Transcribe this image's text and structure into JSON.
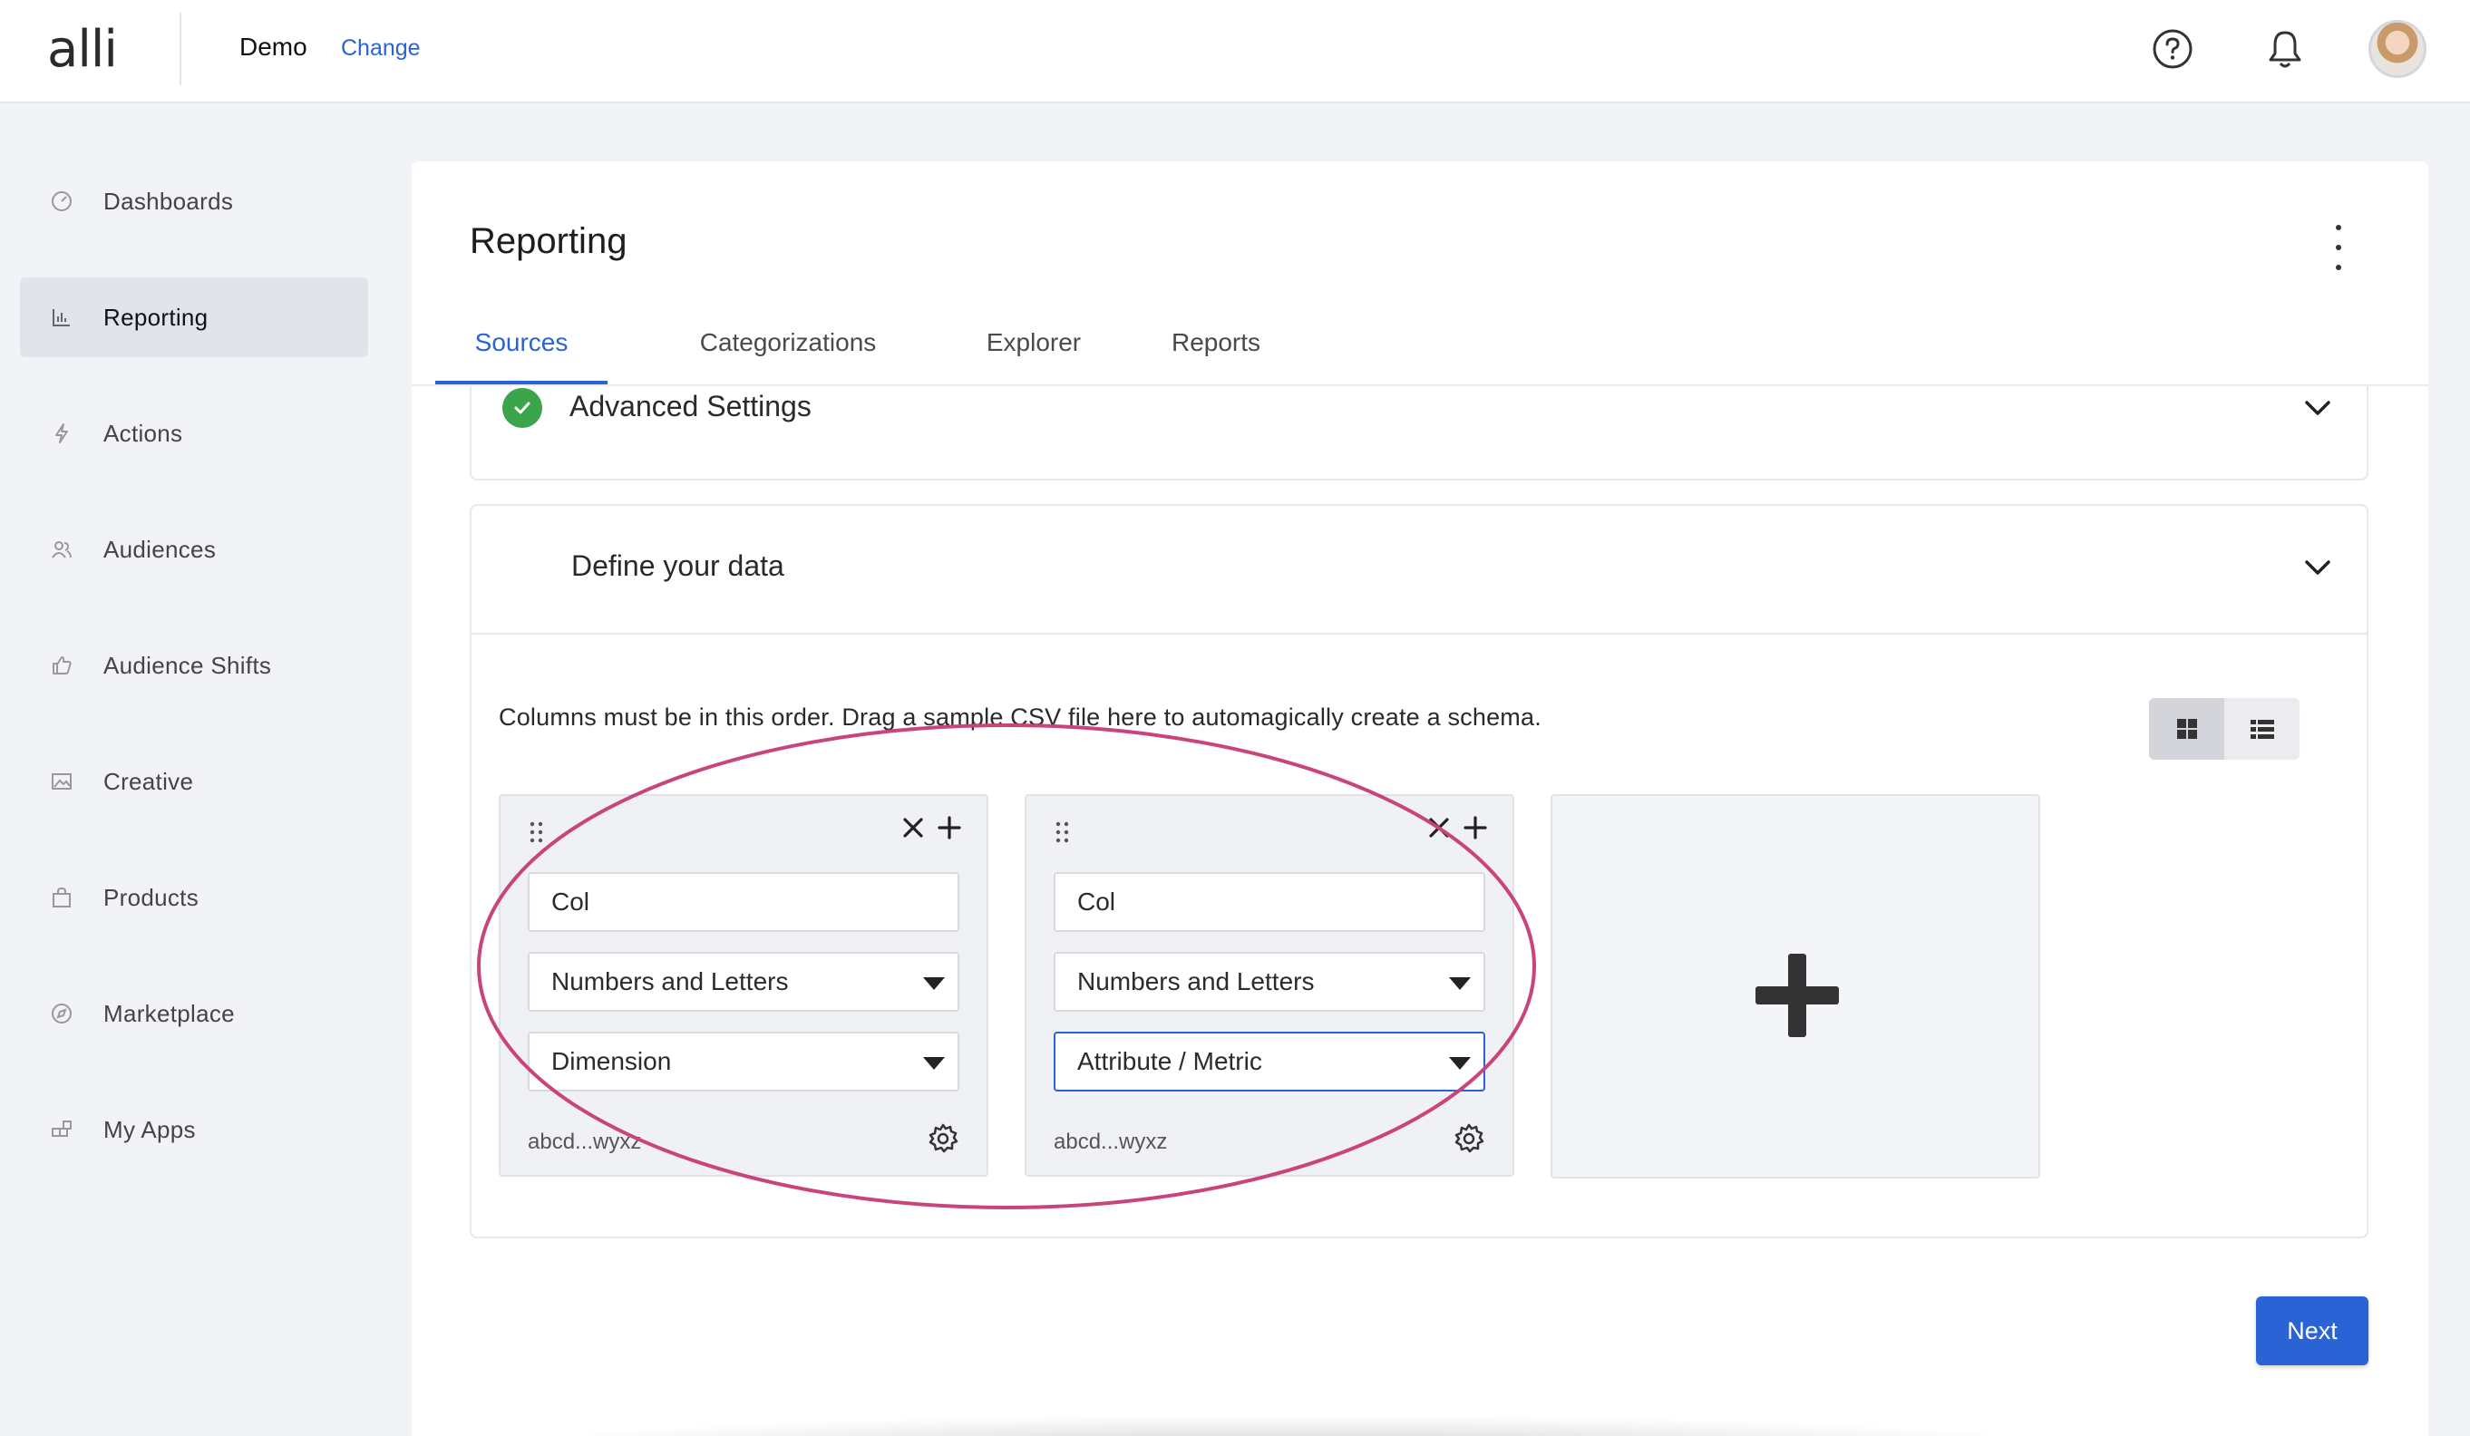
{
  "header": {
    "logo_text": "alli",
    "client_name": "Demo",
    "change_label": "Change",
    "icons": [
      "help-icon",
      "bell-icon",
      "avatar"
    ]
  },
  "sidebar": {
    "items": [
      {
        "label": "Dashboards",
        "icon": "gauge-icon",
        "active": false
      },
      {
        "label": "Reporting",
        "icon": "bar-chart-icon",
        "active": true
      },
      {
        "label": "Actions",
        "icon": "lightning-icon",
        "active": false
      },
      {
        "label": "Audiences",
        "icon": "people-icon",
        "active": false
      },
      {
        "label": "Audience Shifts",
        "icon": "thumbs-up-icon",
        "active": false
      },
      {
        "label": "Creative",
        "icon": "image-icon",
        "active": false
      },
      {
        "label": "Products",
        "icon": "bag-icon",
        "active": false
      },
      {
        "label": "Marketplace",
        "icon": "compass-icon",
        "active": false
      },
      {
        "label": "My Apps",
        "icon": "apps-icon",
        "active": false
      }
    ]
  },
  "main": {
    "title": "Reporting",
    "tabs": [
      {
        "label": "Sources",
        "active": true
      },
      {
        "label": "Categorizations",
        "active": false
      },
      {
        "label": "Explorer",
        "active": false
      },
      {
        "label": "Reports",
        "active": false
      }
    ],
    "advanced_settings": {
      "title": "Advanced Settings",
      "status": "complete"
    },
    "define_data": {
      "title": "Define your data",
      "instructions": "Columns must be in this order. Drag a sample CSV file here to automagically create a schema.",
      "view_mode": "grid",
      "columns": [
        {
          "name": "Col",
          "data_type": "Numbers and Letters",
          "role": "Dimension",
          "sample": "abcd...wyxz"
        },
        {
          "name": "Col",
          "data_type": "Numbers and Letters",
          "role": "Attribute / Metric",
          "sample": "abcd...wyxz"
        }
      ]
    },
    "next_label": "Next"
  },
  "colors": {
    "accent": "#2a63d6",
    "success": "#3aa54b",
    "annotation": "#c8447a"
  }
}
